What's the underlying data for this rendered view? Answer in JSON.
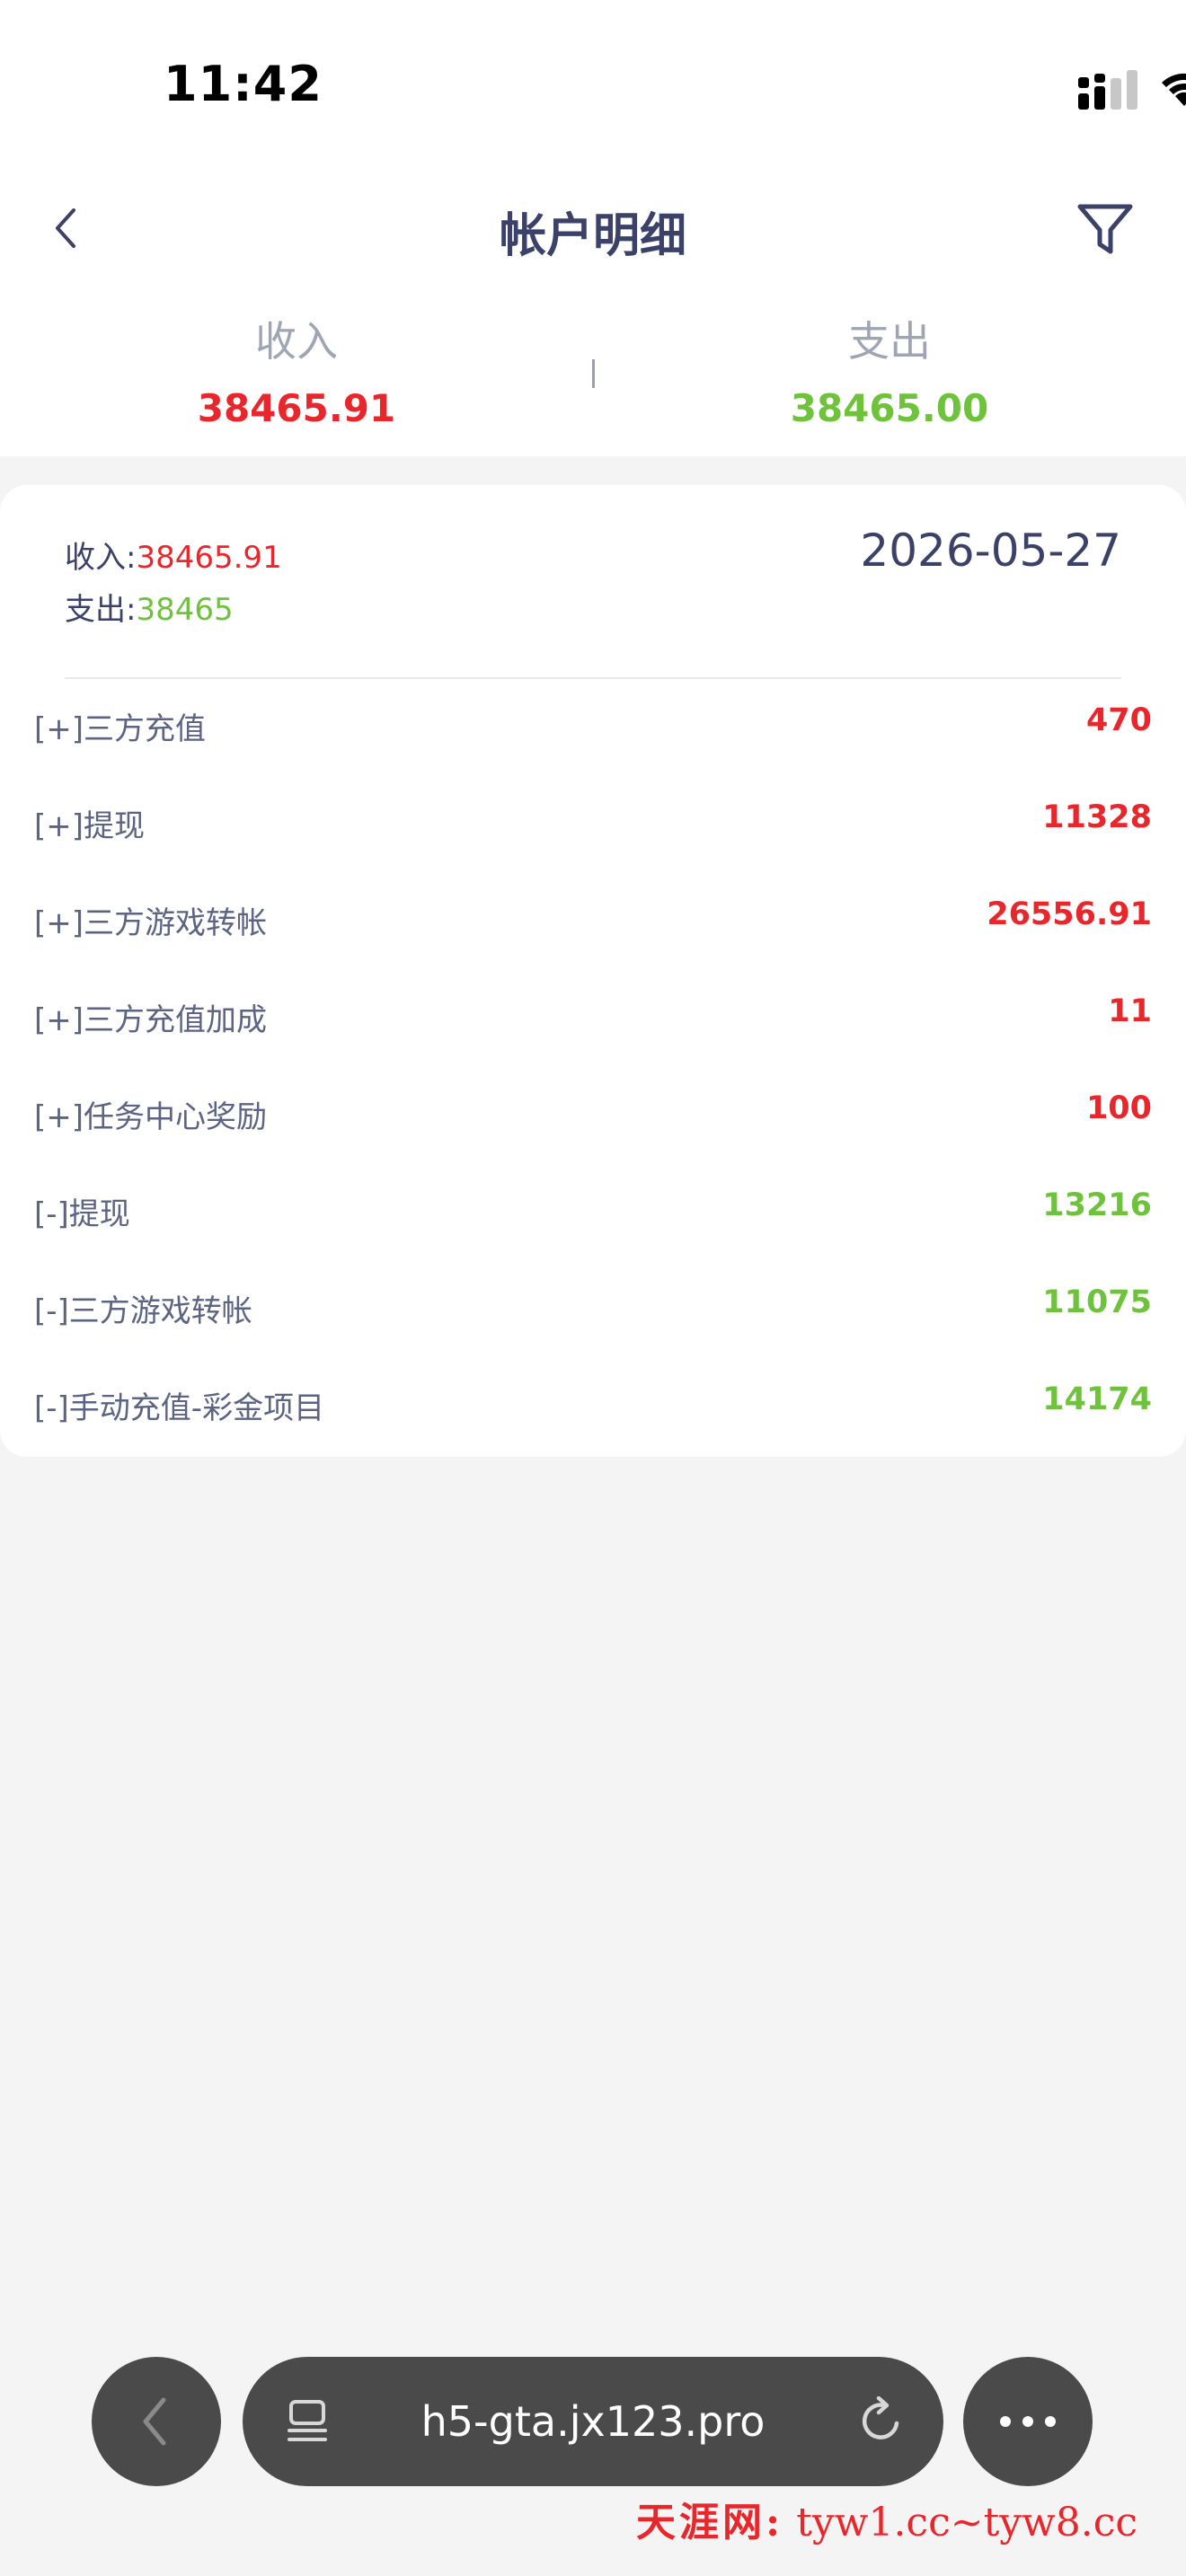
{
  "status_bar": {
    "time": "11:42"
  },
  "header": {
    "title": "帐户明细"
  },
  "summary": {
    "income_label": "收入",
    "income_value": "38465.91",
    "expense_label": "支出",
    "expense_value": "38465.00"
  },
  "card": {
    "income_label": "收入:",
    "income_value": "38465.91",
    "expense_label": "支出:",
    "expense_value": "38465",
    "date": "2026-05-27",
    "rows": [
      {
        "label": "[+]三方充值",
        "value": "470",
        "type": "income"
      },
      {
        "label": "[+]提现",
        "value": "11328",
        "type": "income"
      },
      {
        "label": "[+]三方游戏转帐",
        "value": "26556.91",
        "type": "income"
      },
      {
        "label": "[+]三方充值加成",
        "value": "11",
        "type": "income"
      },
      {
        "label": "[+]任务中心奖励",
        "value": "100",
        "type": "income"
      },
      {
        "label": "[-]提现",
        "value": "13216",
        "type": "expense"
      },
      {
        "label": "[-]三方游戏转帐",
        "value": "11075",
        "type": "expense"
      },
      {
        "label": "[-]手动充值-彩金项目",
        "value": "14174",
        "type": "expense"
      }
    ]
  },
  "browser": {
    "url": "h5-gta.jx123.pro"
  },
  "watermark": {
    "brand": "天涯网:",
    "text": "tyw1.cc~tyw8.cc"
  },
  "colors": {
    "income": "#e8272c",
    "expense": "#6fc23c",
    "title": "#3b4168"
  },
  "icons": [
    "signal-icon",
    "wifi-icon",
    "battery-icon",
    "back-chevron-icon",
    "filter-icon",
    "tabs-icon",
    "reload-icon",
    "more-icon"
  ]
}
